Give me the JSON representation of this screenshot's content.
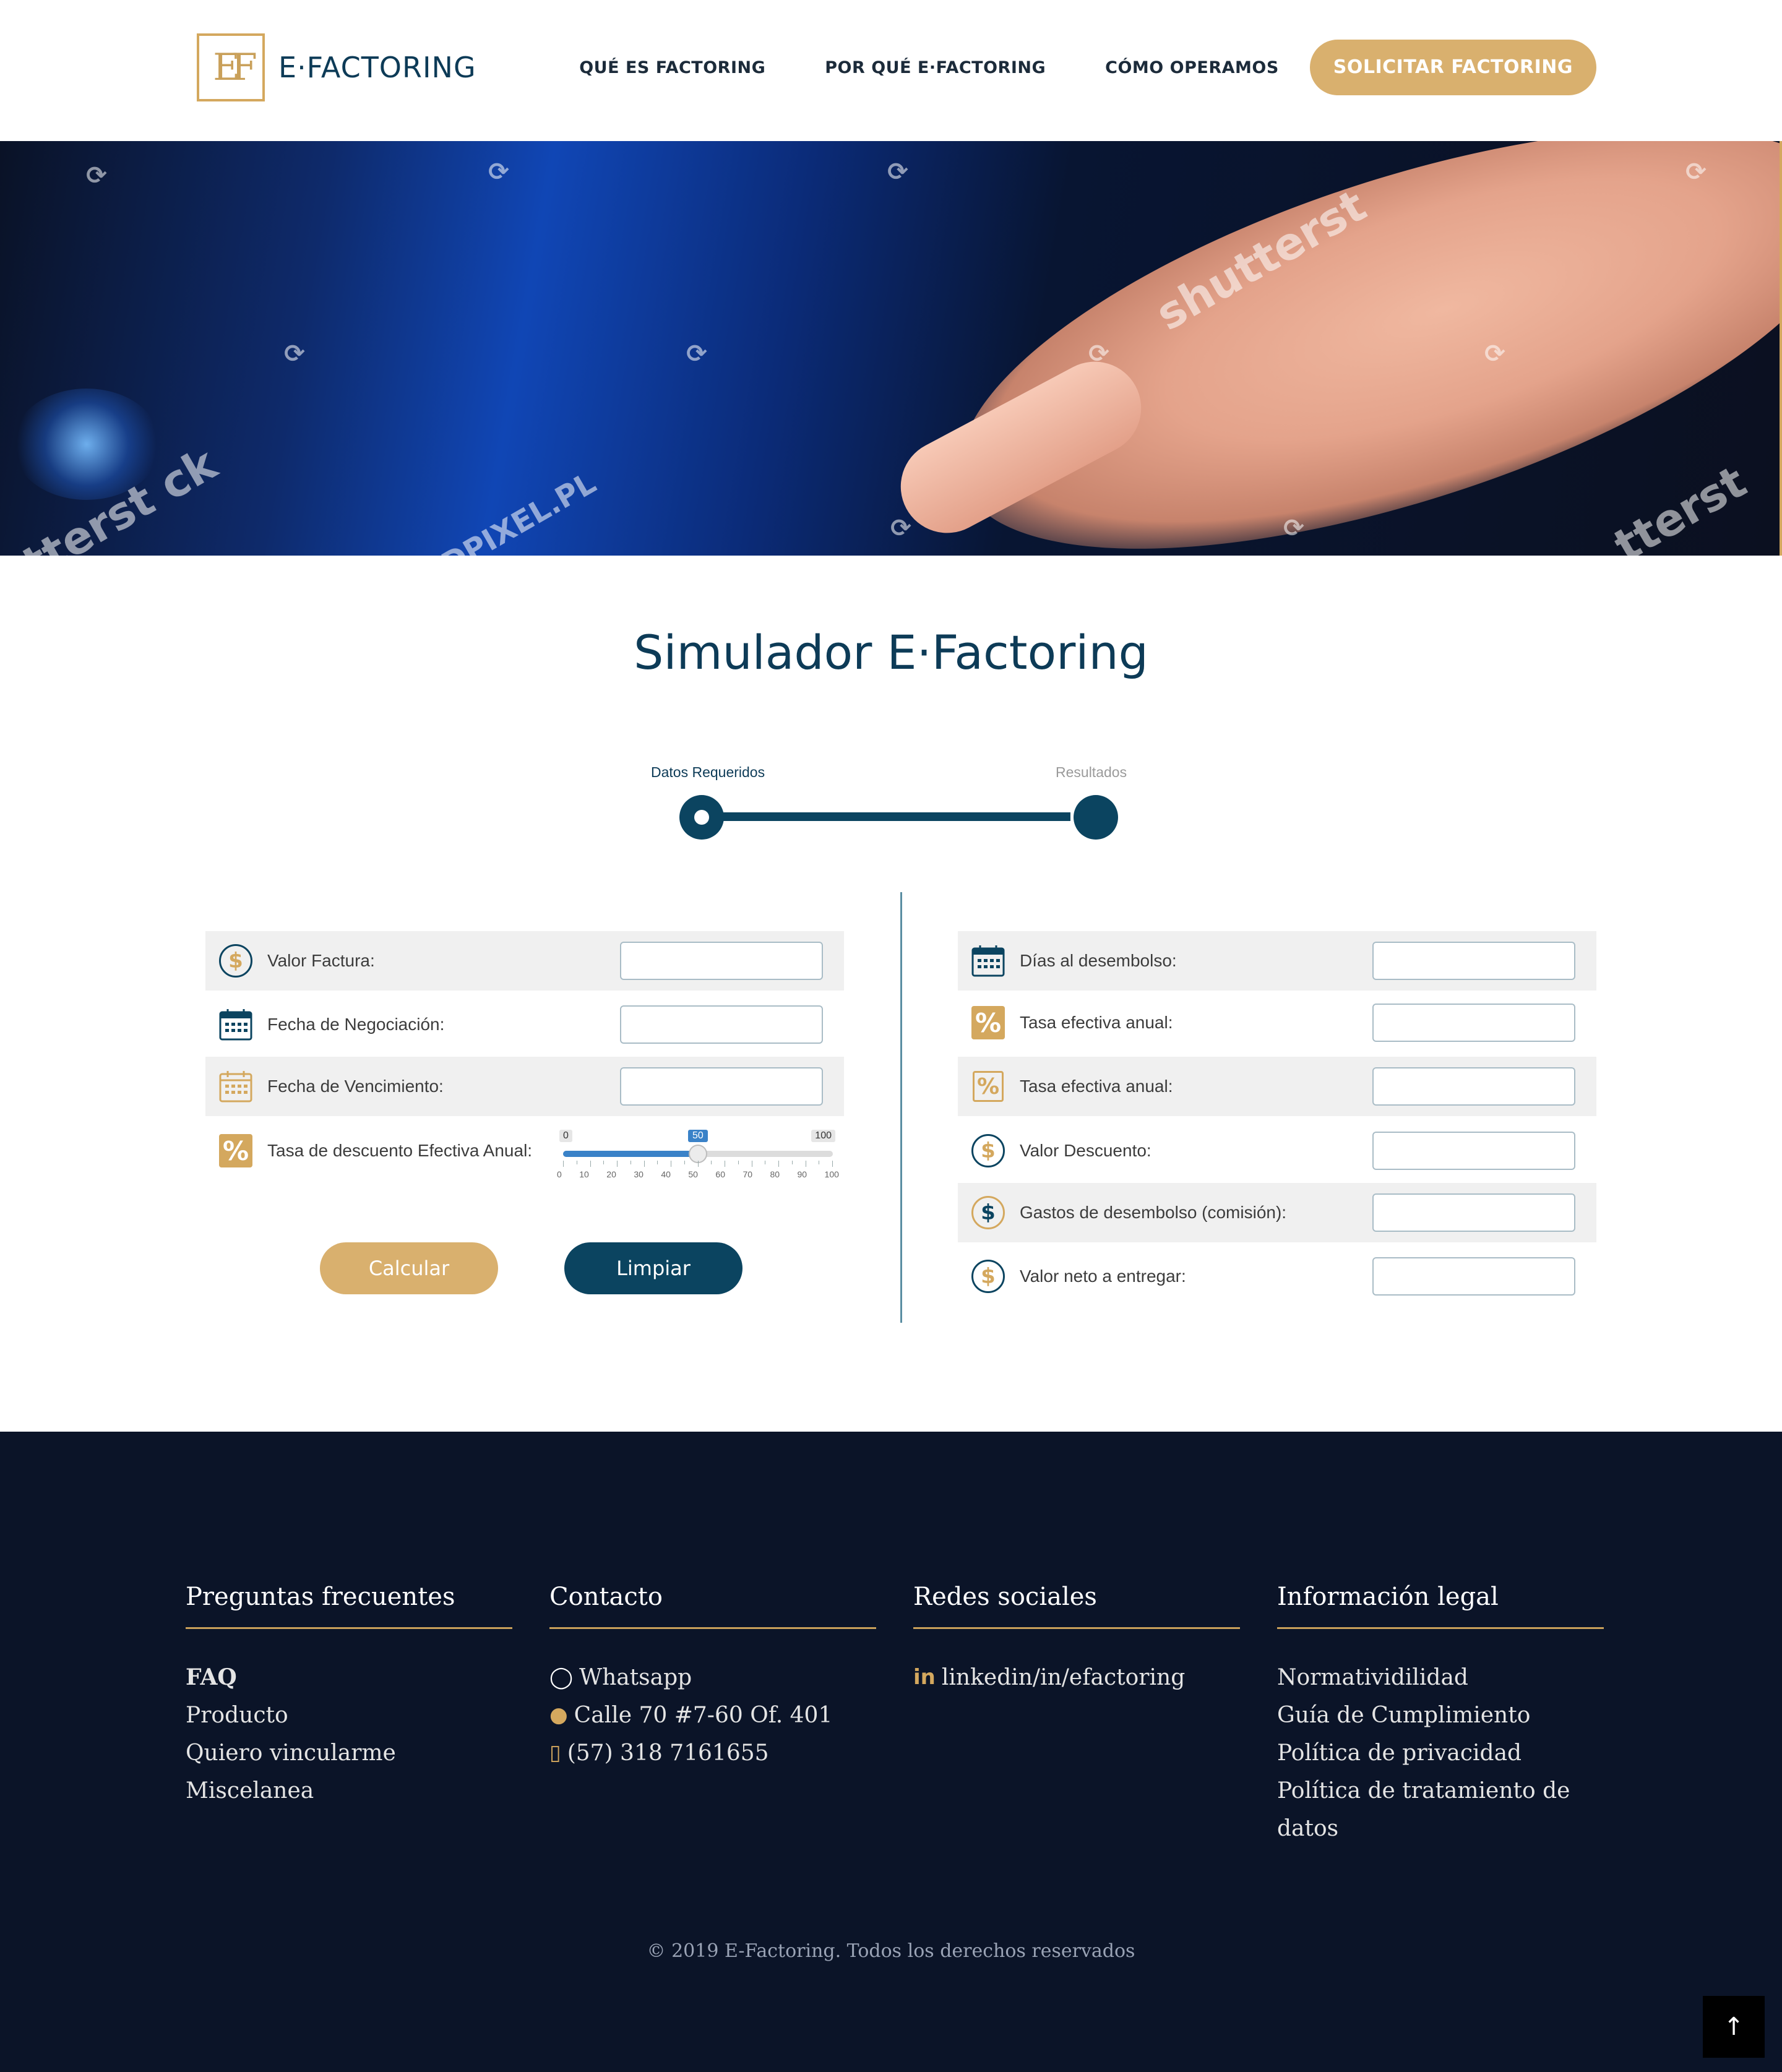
{
  "brand": {
    "mark": "EF",
    "name": "E·FACTORING"
  },
  "nav": {
    "items": [
      "QUÉ ES FACTORING",
      "POR QUÉ E·FACTORING",
      "CÓMO OPERAMOS"
    ],
    "cta": "SOLICITAR FACTORING"
  },
  "hero": {
    "watermarks": [
      "shutterst",
      "tterst ck",
      "DPIXEL.PL",
      "tterst"
    ],
    "colors": {
      "accent": "#d4a85e"
    }
  },
  "simulator": {
    "title": "Simulador E·Factoring",
    "steps": [
      "Datos Requeridos",
      "Resultados"
    ],
    "left_fields": [
      {
        "label": "Valor Factura:",
        "icon": "dollar-circle-icon",
        "value": ""
      },
      {
        "label": "Fecha de Negociación:",
        "icon": "calendar-icon",
        "value": ""
      },
      {
        "label": "Fecha de Vencimiento:",
        "icon": "calendar-outline-icon",
        "value": ""
      }
    ],
    "slider": {
      "label": "Tasa de descuento Efectiva Anual:",
      "icon": "percent-icon",
      "min": "0",
      "max": "100",
      "value": "50",
      "value_num": 50,
      "tick_labels": [
        "0",
        "10",
        "20",
        "30",
        "40",
        "50",
        "60",
        "70",
        "80",
        "90",
        "100"
      ]
    },
    "buttons": {
      "calculate": "Calcular",
      "clear": "Limpiar"
    },
    "right_fields": [
      {
        "label": "Días al desembolso:",
        "icon": "calendar-icon",
        "value": ""
      },
      {
        "label": "Tasa efectiva anual:",
        "icon": "percent-icon",
        "value": ""
      },
      {
        "label": "Tasa efectiva anual:",
        "icon": "percent-outline-icon",
        "value": ""
      },
      {
        "label": "Valor Descuento:",
        "icon": "dollar-circle-icon",
        "value": ""
      },
      {
        "label": "Gastos de desembolso (comisión):",
        "icon": "dollar-circle-icon",
        "value": ""
      },
      {
        "label": "Valor neto a entregar:",
        "icon": "dollar-circle-icon",
        "value": ""
      }
    ]
  },
  "footer": {
    "faq": {
      "title": "Preguntas frecuentes",
      "items": [
        "FAQ",
        "Producto",
        "Quiero vincularme",
        "Miscelanea"
      ]
    },
    "contact": {
      "title": "Contacto",
      "items": [
        "Whatsapp",
        "Calle 70 #7-60 Of. 401",
        "(57) 318 7161655"
      ]
    },
    "social": {
      "title": "Redes sociales",
      "items": [
        "linkedin/in/efactoring"
      ]
    },
    "legal": {
      "title": "Información legal",
      "items": [
        "Normatividilidad",
        "Guía de Cumplimiento",
        "Política de privacidad",
        "Política de tratamiento de datos"
      ]
    },
    "copyright": "© 2019 E-Factoring. Todos los derechos reservados"
  }
}
